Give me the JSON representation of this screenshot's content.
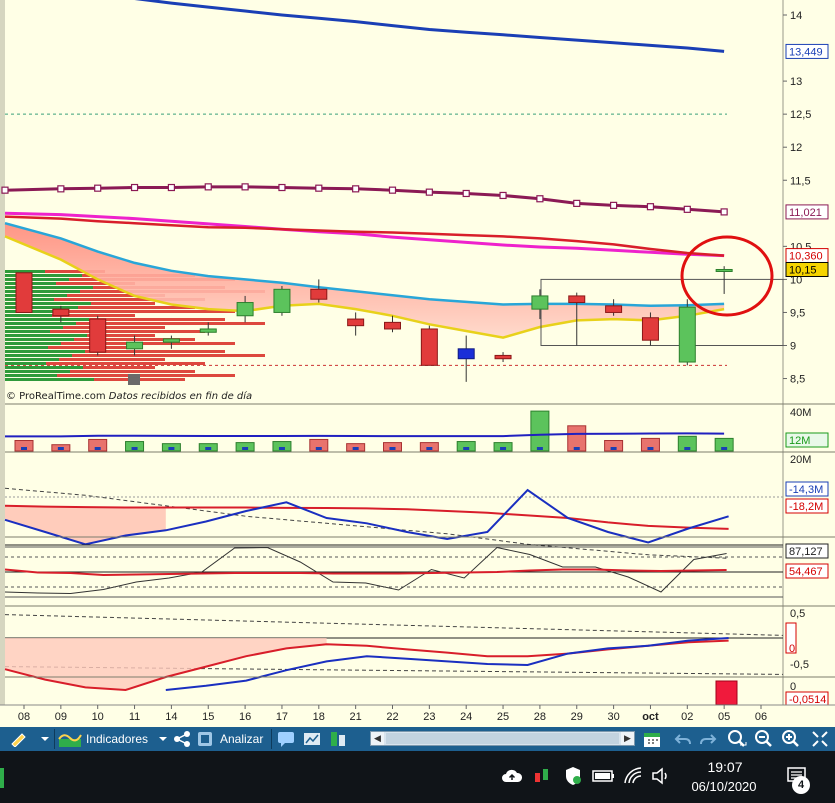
{
  "price_panel": {
    "y_ticks": [
      "14",
      "13",
      "12,5",
      "12",
      "11,5",
      "10,5",
      "10",
      "9,5",
      "9",
      "8,5"
    ],
    "tags": [
      {
        "text": "13,449",
        "value": 13.449,
        "color": "#1a3fb5",
        "bg": "#ffffff"
      },
      {
        "text": "11,021",
        "value": 11.021,
        "color": "#8b1a55",
        "bg": "#ffffff"
      },
      {
        "text": "10,360",
        "value": 10.36,
        "color": "#d40000",
        "bg": "#ffffff"
      },
      {
        "text": "10,15",
        "value": 10.15,
        "color": "#000000",
        "bg": "#f5d400"
      }
    ],
    "credit_source": "© ProRealTime.com",
    "credit_note": "Datos recibidos en fin de día"
  },
  "volume_panel": {
    "ticks": [
      "40M"
    ],
    "tags": [
      {
        "text": "12M",
        "color": "#1a9a1a",
        "bg": "#e9f9e9",
        "label_y": 440
      }
    ]
  },
  "flow_panel": {
    "ticks": [
      "20M"
    ],
    "tags": [
      {
        "text": "-14,3M",
        "color": "#1a3fb5",
        "bg": "#ffffff"
      },
      {
        "text": "-18,2M",
        "color": "#d40000",
        "bg": "#ffffff"
      }
    ]
  },
  "stoch_panel": {
    "tags": [
      {
        "text": "87,127",
        "color": "#222222",
        "bg": "#ffffff"
      },
      {
        "text": "54,467",
        "color": "#d40000",
        "bg": "#ffffff"
      }
    ]
  },
  "osc_panel": {
    "ticks": [
      "0,5",
      "-0,5"
    ],
    "tags": [
      {
        "text": "0",
        "color": "#d40000",
        "bg": "#ffffff"
      }
    ]
  },
  "hist_panel": {
    "ticks": [
      "0"
    ],
    "tags": [
      {
        "text": "-0,0514",
        "color": "#d40000",
        "bg": "#ffffff"
      }
    ]
  },
  "x_axis": {
    "labels": [
      "08",
      "09",
      "10",
      "11",
      "14",
      "15",
      "16",
      "17",
      "18",
      "21",
      "22",
      "23",
      "24",
      "25",
      "28",
      "29",
      "30",
      "oct",
      "02",
      "05",
      "06"
    ]
  },
  "chart_data": {
    "type": "candlestick",
    "x": [
      "08",
      "09",
      "10",
      "11",
      "14",
      "15",
      "16",
      "17",
      "18",
      "21",
      "22",
      "23",
      "24",
      "25",
      "28",
      "29",
      "30",
      "oct",
      "02",
      "05"
    ],
    "ohlc": [
      [
        10.1,
        10.1,
        9.5,
        9.5
      ],
      [
        9.55,
        9.6,
        9.35,
        9.45
      ],
      [
        9.4,
        9.45,
        8.85,
        8.9
      ],
      [
        8.95,
        9.15,
        8.85,
        9.05
      ],
      [
        9.05,
        9.15,
        8.95,
        9.1
      ],
      [
        9.2,
        9.35,
        9.15,
        9.25
      ],
      [
        9.45,
        9.75,
        9.35,
        9.65
      ],
      [
        9.5,
        9.9,
        9.45,
        9.85
      ],
      [
        9.85,
        10.0,
        9.65,
        9.7
      ],
      [
        9.4,
        9.5,
        9.15,
        9.3
      ],
      [
        9.35,
        9.45,
        9.2,
        9.25
      ],
      [
        9.25,
        9.3,
        8.7,
        8.7
      ],
      [
        8.95,
        9.15,
        8.45,
        8.8
      ],
      [
        8.85,
        8.9,
        8.75,
        8.8
      ],
      [
        9.55,
        9.85,
        9.4,
        9.75
      ],
      [
        9.75,
        9.8,
        9.0,
        9.65
      ],
      [
        9.6,
        9.7,
        9.45,
        9.5
      ],
      [
        9.42,
        9.5,
        9.0,
        9.08
      ],
      [
        8.75,
        9.7,
        8.7,
        9.58
      ],
      [
        10.15,
        10.2,
        9.78,
        10.15
      ]
    ],
    "ma_blue_dark": [
      14.4,
      14.36,
      14.3,
      14.25,
      14.18,
      14.12,
      14.06,
      14.0,
      13.95,
      13.9,
      13.84,
      13.78,
      13.74,
      13.7,
      13.66,
      13.62,
      13.58,
      13.54,
      13.5,
      13.449
    ],
    "ma_maroon": [
      11.35,
      11.37,
      11.38,
      11.39,
      11.39,
      11.4,
      11.4,
      11.39,
      11.38,
      11.37,
      11.35,
      11.32,
      11.3,
      11.27,
      11.22,
      11.15,
      11.12,
      11.1,
      11.06,
      11.021
    ],
    "ma_magenta": [
      11.0,
      10.98,
      10.95,
      10.92,
      10.88,
      10.84,
      10.8,
      10.76,
      10.72,
      10.69,
      10.64,
      10.6,
      10.56,
      10.52,
      10.49,
      10.47,
      10.44,
      10.41,
      10.38,
      10.36
    ],
    "ma_red": [
      10.95,
      10.92,
      10.88,
      10.85,
      10.82,
      10.79,
      10.78,
      10.76,
      10.74,
      10.72,
      10.71,
      10.69,
      10.67,
      10.65,
      10.62,
      10.58,
      10.53,
      10.46,
      10.4,
      10.36
    ],
    "ma_cyan": [
      10.85,
      10.62,
      10.42,
      10.25,
      10.13,
      10.05,
      10.0,
      9.95,
      9.88,
      9.82,
      9.76,
      9.7,
      9.66,
      9.62,
      9.63,
      9.63,
      9.62,
      9.6,
      9.61,
      9.63
    ],
    "ma_yellow": [
      10.65,
      10.3,
      10.0,
      9.75,
      9.62,
      9.55,
      9.52,
      9.6,
      9.63,
      9.55,
      9.45,
      9.32,
      9.22,
      9.12,
      9.28,
      9.38,
      9.4,
      9.38,
      9.45,
      9.55
    ],
    "hline_dashed_green": 12.5,
    "hline_dashed_red": 8.7,
    "volume": [
      {
        "v": 10,
        "c": "red"
      },
      {
        "v": 6,
        "c": "red"
      },
      {
        "v": 11,
        "c": "red"
      },
      {
        "v": 9,
        "c": "green"
      },
      {
        "v": 7,
        "c": "green"
      },
      {
        "v": 7,
        "c": "green"
      },
      {
        "v": 8,
        "c": "green"
      },
      {
        "v": 9,
        "c": "green"
      },
      {
        "v": 11,
        "c": "red"
      },
      {
        "v": 7,
        "c": "red"
      },
      {
        "v": 8,
        "c": "red"
      },
      {
        "v": 8,
        "c": "red"
      },
      {
        "v": 9,
        "c": "green"
      },
      {
        "v": 8,
        "c": "green"
      },
      {
        "v": 38,
        "c": "green"
      },
      {
        "v": 24,
        "c": "red"
      },
      {
        "v": 10,
        "c": "red"
      },
      {
        "v": 12,
        "c": "red"
      },
      {
        "v": 14,
        "c": "green"
      },
      {
        "v": 12,
        "c": "green"
      }
    ],
    "volume_ma": [
      13,
      13,
      13.5,
      13.5,
      13.4,
      13.3,
      13.3,
      13.3,
      13.4,
      13.3,
      13.2,
      13.2,
      13.2,
      13.2,
      14.5,
      15.3,
      15.5,
      15.7,
      15.8,
      15.6
    ],
    "flow_blue": [
      -13,
      -20,
      -27,
      -22,
      -19,
      -14,
      -8,
      -3,
      -12,
      -15,
      -20,
      -24,
      -20,
      4,
      -12,
      -20,
      -26,
      -18,
      -11
    ],
    "flow_red": [
      -5,
      -5.5,
      -5.8,
      -6,
      -6,
      -6,
      -6,
      -6.2,
      -6.3,
      -6.5,
      -7,
      -8,
      -9,
      -10.5,
      -12,
      -14.5,
      -16.5,
      -17.5,
      -18.2
    ],
    "flow_dashed": [
      5,
      3,
      1,
      -2,
      -5,
      -8,
      -11,
      -13,
      -15,
      -17,
      -19,
      -21,
      -24,
      -27,
      -29,
      -31,
      -33,
      -34,
      -35
    ],
    "stoch_black": [
      10,
      8,
      7,
      15,
      30,
      38,
      50,
      98,
      99,
      70,
      30,
      28,
      14,
      55,
      38,
      99,
      85,
      60,
      60,
      40,
      10,
      75,
      87
    ],
    "stoch_red": [
      55,
      49,
      48,
      44,
      45,
      46,
      47,
      48,
      48,
      48,
      47,
      47,
      47,
      48,
      49,
      50,
      53,
      55,
      55,
      53,
      52,
      53,
      54
    ],
    "osc_red": [
      -0.6,
      -0.8,
      -0.95,
      -1.0,
      -0.75,
      -0.55,
      -0.35,
      -0.2,
      -0.12,
      -0.15,
      -0.22,
      -0.28,
      -0.35,
      -0.35,
      -0.3,
      -0.22,
      -0.15,
      -0.08,
      -0.05
    ],
    "osc_blue": [
      null,
      null,
      null,
      null,
      -1.0,
      -0.92,
      -0.82,
      -0.62,
      -0.45,
      -0.35,
      -0.4,
      -0.45,
      -0.5,
      -0.52,
      -0.3,
      -0.2,
      -0.15,
      -0.05,
      0.0
    ],
    "hist": -0.0514
  },
  "toolbar": {
    "indicators_label": "Indicadores",
    "analyze_label": "Analizar"
  },
  "taskbar": {
    "time": "19:07",
    "date": "06/10/2020",
    "notification_count": "4"
  }
}
